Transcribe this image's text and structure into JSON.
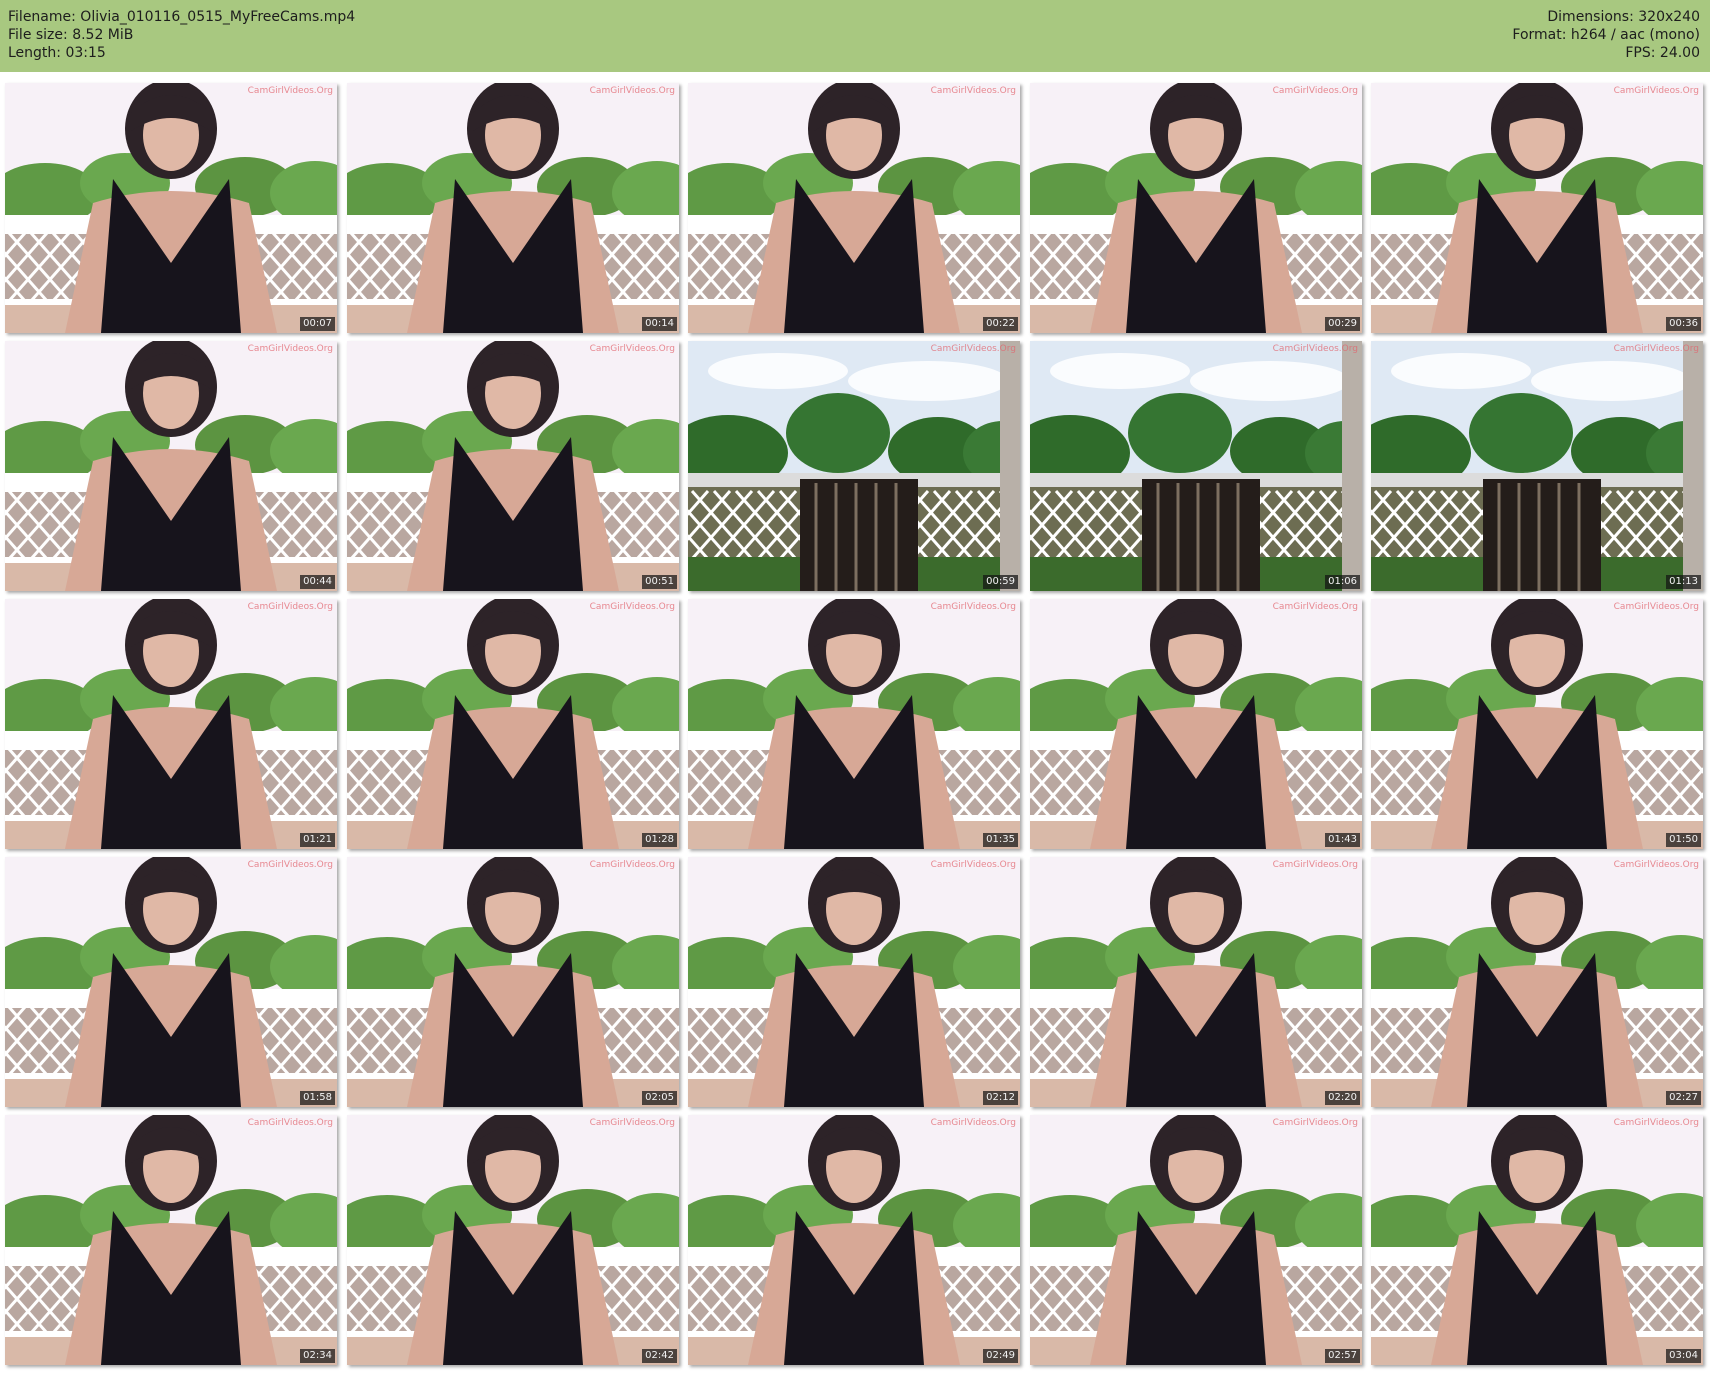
{
  "header": {
    "filename": "Filename: Olivia_010116_0515_MyFreeCams.mp4",
    "filesize": "File size: 8.52 MiB",
    "length": "Length: 03:15",
    "dimensions": "Dimensions: 320x240",
    "format": "Format: h264 / aac (mono)",
    "fps": "FPS: 24.00",
    "background_color": "#a8c880"
  },
  "thumbnails": [
    {
      "time": "00:07",
      "scene": "person",
      "watermark": "CamGirlVideos.Org"
    },
    {
      "time": "00:14",
      "scene": "person",
      "watermark": "CamGirlVideos.Org"
    },
    {
      "time": "00:22",
      "scene": "person",
      "watermark": "CamGirlVideos.Org"
    },
    {
      "time": "00:29",
      "scene": "person",
      "watermark": "CamGirlVideos.Org"
    },
    {
      "time": "00:36",
      "scene": "person",
      "watermark": "CamGirlVideos.Org"
    },
    {
      "time": "00:44",
      "scene": "person",
      "watermark": "CamGirlVideos.Org"
    },
    {
      "time": "00:51",
      "scene": "person",
      "watermark": "CamGirlVideos.Org"
    },
    {
      "time": "00:59",
      "scene": "empty",
      "watermark": "CamGirlVideos.Org"
    },
    {
      "time": "01:06",
      "scene": "empty",
      "watermark": "CamGirlVideos.Org"
    },
    {
      "time": "01:13",
      "scene": "empty",
      "watermark": "CamGirlVideos.Org"
    },
    {
      "time": "01:21",
      "scene": "person",
      "watermark": "CamGirlVideos.Org"
    },
    {
      "time": "01:28",
      "scene": "person",
      "watermark": "CamGirlVideos.Org"
    },
    {
      "time": "01:35",
      "scene": "person",
      "watermark": "CamGirlVideos.Org"
    },
    {
      "time": "01:43",
      "scene": "person",
      "watermark": "CamGirlVideos.Org"
    },
    {
      "time": "01:50",
      "scene": "person",
      "watermark": "CamGirlVideos.Org"
    },
    {
      "time": "01:58",
      "scene": "person",
      "watermark": "CamGirlVideos.Org"
    },
    {
      "time": "02:05",
      "scene": "person",
      "watermark": "CamGirlVideos.Org"
    },
    {
      "time": "02:12",
      "scene": "person",
      "watermark": "CamGirlVideos.Org"
    },
    {
      "time": "02:20",
      "scene": "person",
      "watermark": "CamGirlVideos.Org"
    },
    {
      "time": "02:27",
      "scene": "person",
      "watermark": "CamGirlVideos.Org"
    },
    {
      "time": "02:34",
      "scene": "person",
      "watermark": "CamGirlVideos.Org"
    },
    {
      "time": "02:42",
      "scene": "person",
      "watermark": "CamGirlVideos.Org"
    },
    {
      "time": "02:49",
      "scene": "person",
      "watermark": "CamGirlVideos.Org"
    },
    {
      "time": "02:57",
      "scene": "person",
      "watermark": "CamGirlVideos.Org"
    },
    {
      "time": "03:04",
      "scene": "person",
      "watermark": "CamGirlVideos.Org"
    }
  ]
}
